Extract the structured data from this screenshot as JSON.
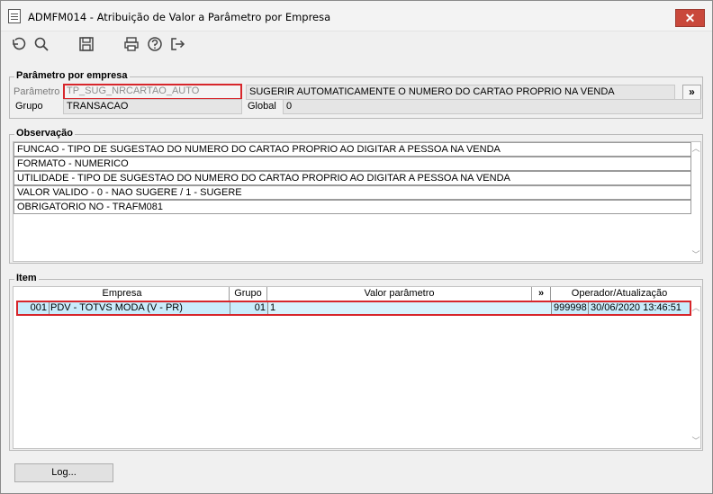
{
  "window": {
    "title": "ADMFM014 - Atribuição de Valor a Parâmetro por Empresa",
    "close_label": "✕"
  },
  "toolbar": {
    "buttons": [
      "undo-icon",
      "search-icon",
      "save-icon",
      "print-icon",
      "help-icon",
      "exit-icon"
    ]
  },
  "parametro": {
    "legend": "Parâmetro por empresa",
    "param_label": "Parâmetro",
    "param_value": "TP_SUG_NRCARTAO_AUTO",
    "description": "SUGERIR AUTOMATICAMENTE O NUMERO DO CARTAO PROPRIO NA VENDA",
    "more_label": "»",
    "grupo_label": "Grupo",
    "grupo_value": "TRANSACAO",
    "global_label": "Global",
    "global_value": "0"
  },
  "observacao": {
    "legend": "Observação",
    "lines": [
      "FUNCAO - TIPO DE SUGESTAO DO NUMERO DO CARTAO PROPRIO AO DIGITAR A PESSOA NA VENDA",
      "FORMATO - NUMERICO",
      "UTILIDADE - TIPO DE SUGESTAO DO NUMERO DO CARTAO PROPRIO AO DIGITAR A PESSOA NA VENDA",
      "VALOR VALIDO - 0 - NAO SUGERE   / 1 - SUGERE",
      "OBRIGATORIO NO - TRAFM081"
    ]
  },
  "item": {
    "legend": "Item",
    "headers": {
      "empresa": "Empresa",
      "grupo": "Grupo",
      "valor": "Valor parâmetro",
      "more": "»",
      "operador": "Operador/Atualização"
    },
    "row": {
      "codigo": "001",
      "empresa": "PDV - TOTVS MODA (V - PR)",
      "grupo": "01",
      "valor": "1",
      "operador": "999998",
      "atualizacao": "30/06/2020 13:46:51"
    }
  },
  "footer": {
    "log_label": "Log..."
  }
}
